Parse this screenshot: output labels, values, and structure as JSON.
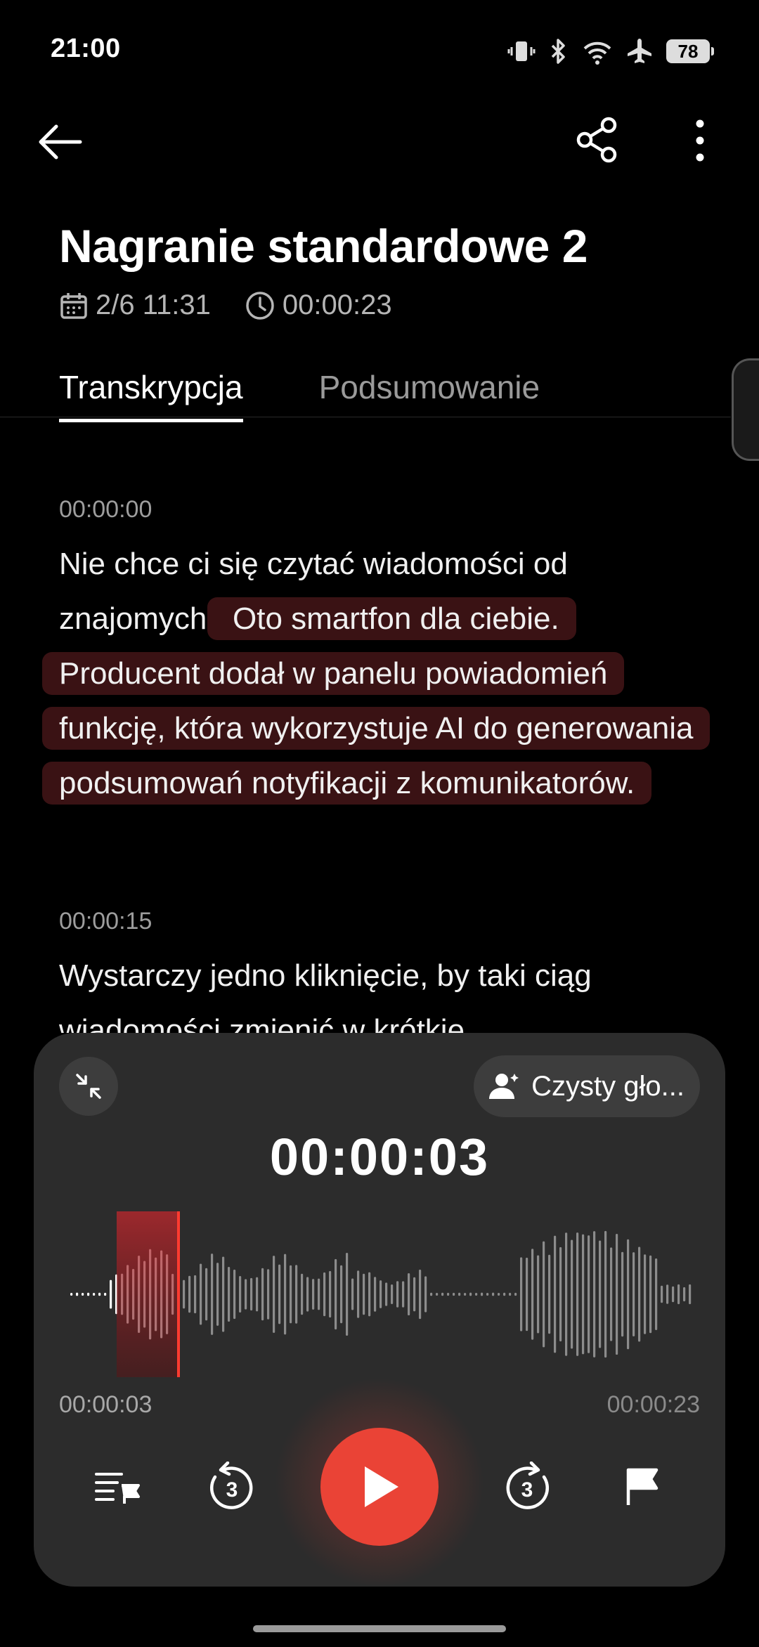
{
  "status_bar": {
    "time": "21:00",
    "battery": "78"
  },
  "header": {
    "title": "Nagranie standardowe 2",
    "date": "2/6 11:31",
    "duration": "00:00:23"
  },
  "tabs": [
    {
      "label": "Transkrypcja",
      "active": true
    },
    {
      "label": "Podsumowanie",
      "active": false
    }
  ],
  "transcript": [
    {
      "timestamp": "00:00:00",
      "text_plain": "Nie chce ci się czytać wiadomości od znajomych?",
      "text_highlighted": " Oto smartfon dla ciebie. Producent dodał w panelu powiadomień funkcję, która wykorzystuje AI do generowania podsumowań notyfikacji z komunikatorów."
    },
    {
      "timestamp": "00:00:15",
      "text_plain": " Wystarczy jedno kliknięcie, by taki ciąg wiadomości zmienić w krótkie"
    }
  ],
  "player": {
    "mode_label": "Czysty gło...",
    "current_time_big": "00:00:03",
    "current_time": "00:00:03",
    "total_time": "00:00:23",
    "progress": 0.13,
    "skip_seconds": "3"
  },
  "colors": {
    "accent": "#ea4336",
    "highlight_bg": "#3a1214",
    "player_bg": "#2c2c2c"
  }
}
